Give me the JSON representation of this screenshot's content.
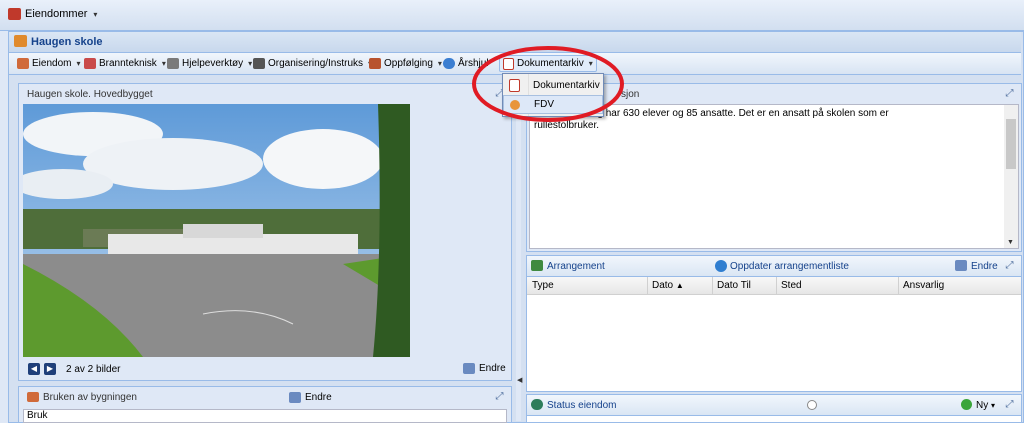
{
  "topbar": {
    "menu_label": "Eiendommer"
  },
  "window": {
    "title": "Haugen skole"
  },
  "toolbar": {
    "items": [
      {
        "label": "Eiendom"
      },
      {
        "label": "Brannteknisk"
      },
      {
        "label": "Hjelpeverktøy"
      },
      {
        "label": "Organisering/Instruks"
      },
      {
        "label": "Oppfølging"
      },
      {
        "label": "Årshjul"
      },
      {
        "label": "Dokumentarkiv"
      }
    ]
  },
  "dropdown": {
    "items": [
      {
        "label": "Dokumentarkiv"
      },
      {
        "label": "FDV"
      }
    ]
  },
  "image_panel": {
    "title": "Haugen skole. Hovedbygget",
    "pager_text": "2 av 2 bilder",
    "edit_label": "Endre"
  },
  "usage_panel": {
    "title": "Bruken av bygningen",
    "edit_label": "Endre",
    "field_label": "Bruk"
  },
  "description_panel": {
    "title_fragment": "sjon",
    "text_line1": "en 1-7-skole og har 630 elever og 85 ansatte. Det er en ansatt på skolen som er",
    "text_line2": "rullestolbruker."
  },
  "arrangement_panel": {
    "title": "Arrangement",
    "refresh_label": "Oppdater arrangementliste",
    "edit_label": "Endre",
    "columns": [
      "Type",
      "Dato",
      "Dato Til",
      "Sted",
      "Ansvarlig"
    ]
  },
  "status_panel": {
    "title": "Status eiendom",
    "new_label": "Ny"
  },
  "colors": {
    "accent": "#15428b",
    "border": "#99bbe8",
    "highlight": "#e01b24"
  }
}
